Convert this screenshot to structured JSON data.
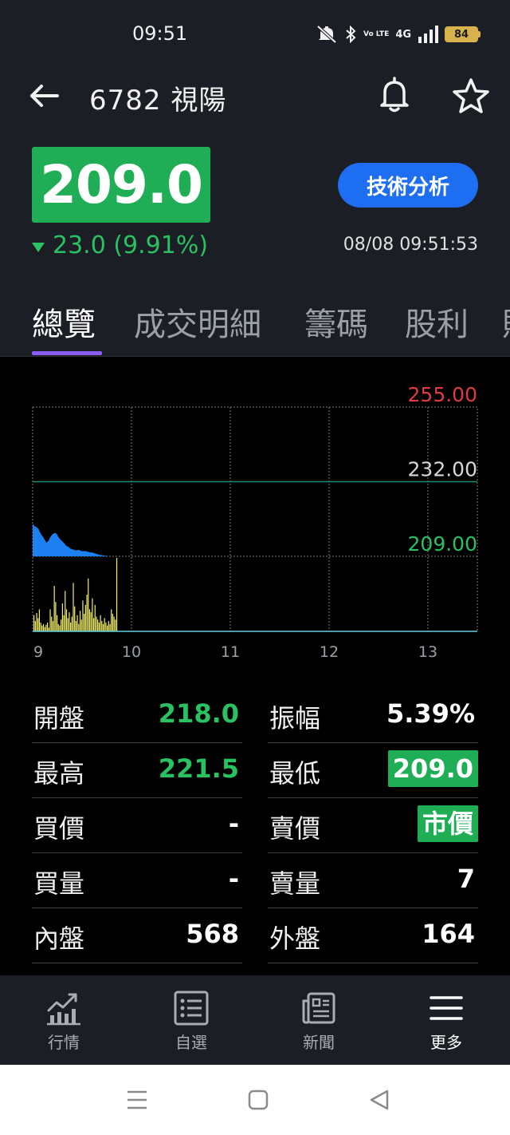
{
  "status_bar": {
    "time": "09:51",
    "volte": "Vo LTE",
    "network": "4G",
    "battery": "84"
  },
  "header": {
    "title": "6782 視陽"
  },
  "quote": {
    "price": "209.0",
    "change": "23.0 (9.91%)",
    "direction": "down",
    "timestamp": "08/08 09:51:53",
    "tech_button": "技術分析"
  },
  "tabs": [
    "總覽",
    "成交明細",
    "籌碼",
    "股利"
  ],
  "chart_data": {
    "type": "area",
    "price_levels": [
      {
        "label": "255.00",
        "value": 255.0,
        "color": "#e0393e"
      },
      {
        "label": "232.00",
        "value": 232.0,
        "color": "#d8d8d8"
      },
      {
        "label": "209.00",
        "value": 209.0,
        "color": "#29c162"
      }
    ],
    "reference_price": 232.0,
    "ylim": [
      209.0,
      255.0
    ],
    "x_ticks": [
      "9",
      "10",
      "11",
      "12",
      "13"
    ],
    "x_range_hours": [
      9,
      13.5
    ],
    "price_series": [
      [
        9.0,
        219.0
      ],
      [
        9.02,
        218.3
      ],
      [
        9.04,
        218.0
      ],
      [
        9.06,
        217.4
      ],
      [
        9.08,
        216.0
      ],
      [
        9.1,
        215.2
      ],
      [
        9.12,
        214.2
      ],
      [
        9.14,
        213.2
      ],
      [
        9.16,
        213.8
      ],
      [
        9.18,
        215.0
      ],
      [
        9.2,
        215.8
      ],
      [
        9.22,
        216.2
      ],
      [
        9.24,
        216.0
      ],
      [
        9.26,
        215.0
      ],
      [
        9.28,
        214.2
      ],
      [
        9.3,
        213.6
      ],
      [
        9.32,
        213.0
      ],
      [
        9.34,
        212.2
      ],
      [
        9.36,
        212.0
      ],
      [
        9.38,
        211.4
      ],
      [
        9.4,
        211.2
      ],
      [
        9.42,
        211.0
      ],
      [
        9.44,
        210.8
      ],
      [
        9.46,
        211.0
      ],
      [
        9.48,
        210.8
      ],
      [
        9.5,
        210.6
      ],
      [
        9.52,
        210.6
      ],
      [
        9.54,
        210.6
      ],
      [
        9.56,
        210.4
      ],
      [
        9.58,
        210.2
      ],
      [
        9.6,
        210.2
      ],
      [
        9.62,
        210.0
      ],
      [
        9.64,
        209.8
      ],
      [
        9.66,
        209.6
      ],
      [
        9.68,
        209.4
      ],
      [
        9.7,
        209.4
      ],
      [
        9.72,
        209.2
      ],
      [
        9.74,
        209.2
      ],
      [
        9.76,
        209.0
      ],
      [
        9.78,
        209.0
      ],
      [
        9.8,
        209.0
      ],
      [
        9.83,
        209.0
      ],
      [
        9.86,
        209.0
      ]
    ],
    "volume_series": [
      22,
      14,
      25,
      18,
      30,
      12,
      8,
      10,
      6,
      9,
      12,
      5,
      30,
      20,
      14,
      62,
      40,
      22,
      10,
      8,
      16,
      38,
      22,
      55,
      30,
      18,
      26,
      12,
      20,
      66,
      34,
      14,
      22,
      10,
      28,
      16,
      42,
      24,
      36,
      50,
      72,
      30,
      26,
      45,
      18,
      36,
      20,
      16,
      12,
      22,
      14,
      10,
      18,
      12,
      8,
      14,
      10,
      30,
      24,
      20,
      16,
      100
    ],
    "grid": true
  },
  "stats": {
    "open_label": "開盤",
    "open_value": "218.0",
    "amplitude_label": "振幅",
    "amplitude_value": "5.39%",
    "high_label": "最高",
    "high_value": "221.5",
    "low_label": "最低",
    "low_value": "209.0",
    "bid_label": "買價",
    "bid_value": "-",
    "ask_label": "賣價",
    "ask_value": "市價",
    "bid_vol_label": "買量",
    "bid_vol_value": "-",
    "ask_vol_label": "賣量",
    "ask_vol_value": "7",
    "inner_label": "內盤",
    "inner_value": "568",
    "outer_label": "外盤",
    "outer_value": "164"
  },
  "bottom_nav": [
    {
      "label": "行情",
      "icon": "chart-growth-icon"
    },
    {
      "label": "自選",
      "icon": "list-icon"
    },
    {
      "label": "新聞",
      "icon": "newspaper-icon"
    },
    {
      "label": "更多",
      "icon": "menu-icon"
    }
  ],
  "colors": {
    "up_green": "#29c162",
    "price_bg": "#1fae55",
    "accent_blue": "#1e6ef2",
    "tab_indicator": "#8b5cf6",
    "area_blue": "#1e7ff0",
    "volume_yellow": "#f2ee6b"
  }
}
